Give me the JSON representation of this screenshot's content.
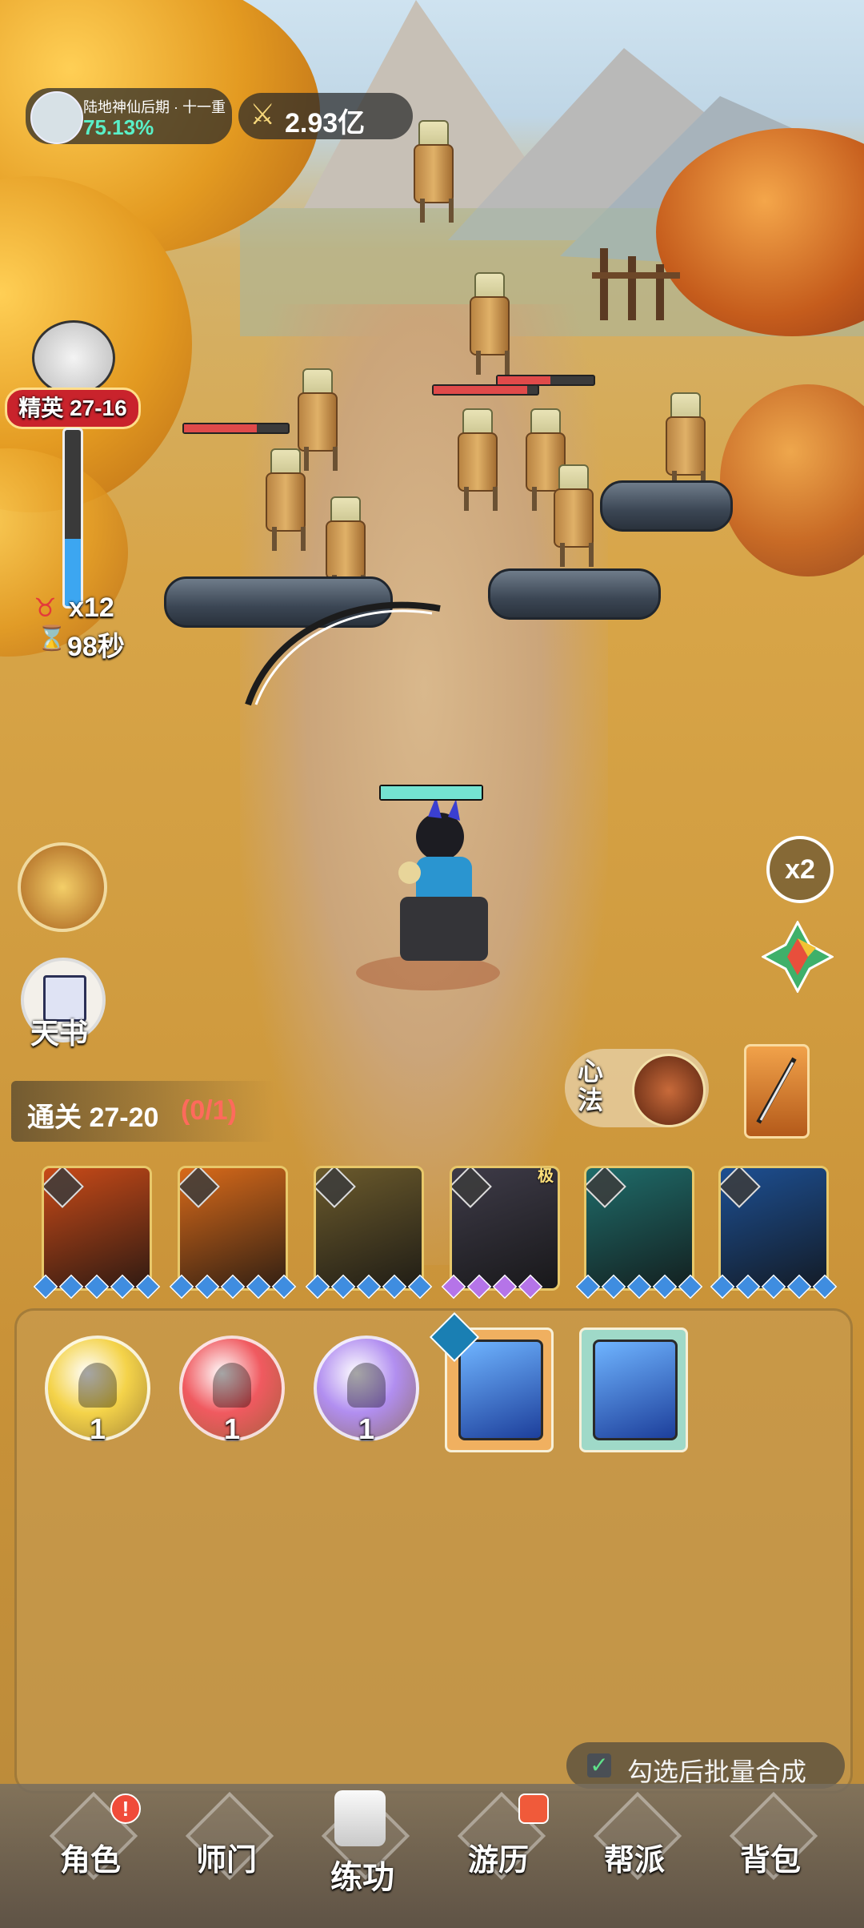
{
  "hud": {
    "realm_label": "陆地神仙后期 · 十一重",
    "realm_progress": "75.13%",
    "power": "2.93亿"
  },
  "stage": {
    "elite_label": "精英 27-16",
    "remaining_waves": "x12",
    "time_left": "98秒",
    "clear_goal_prefix": "通关 27-20",
    "clear_goal_progress": "(0/1)"
  },
  "side_buttons": {
    "tianshu_label": "天书",
    "speed_label": "x2",
    "xinfa_label": "心法"
  },
  "skill_cards": [
    {
      "name": "fire-skill-1",
      "color": "#c84a18",
      "gem_color": "#3f8de0",
      "gems": 5
    },
    {
      "name": "buddha-skill",
      "color": "#d86a1a",
      "gem_color": "#3f8de0",
      "gems": 5
    },
    {
      "name": "blade-skill-1",
      "color": "#6b5a2c",
      "gem_color": "#3f8de0",
      "gems": 5
    },
    {
      "name": "blade-skill-2",
      "color": "#3e3b48",
      "gem_color": "#b574e8",
      "gems": 4
    },
    {
      "name": "jade-skill",
      "color": "#1f6c6a",
      "gem_color": "#3f8de0",
      "gems": 5
    },
    {
      "name": "ice-skill",
      "color": "#1d4f92",
      "gem_color": "#3f8de0",
      "gems": 5
    }
  ],
  "skill_card_corner_tag": "极",
  "inventory": {
    "orbs": [
      {
        "name": "gold-orb",
        "color": "#f4d34a",
        "count": "1"
      },
      {
        "name": "red-orb",
        "color": "#f05a60",
        "count": "1"
      },
      {
        "name": "purple-orb",
        "color": "#b18ef0",
        "count": "1"
      }
    ],
    "books": [
      {
        "name": "palm-skill-book",
        "bg": "#f0b060"
      },
      {
        "name": "ice-skill-book",
        "bg": "#9fd9c8"
      }
    ]
  },
  "batch_merge_label": "勾选后批量合成",
  "nav": [
    {
      "label": "角色",
      "badge": "!"
    },
    {
      "label": "师门",
      "badge": ""
    },
    {
      "label": "练功",
      "badge": ""
    },
    {
      "label": "游历",
      "badge": "gift"
    },
    {
      "label": "帮派",
      "badge": ""
    },
    {
      "label": "背包",
      "badge": ""
    }
  ]
}
